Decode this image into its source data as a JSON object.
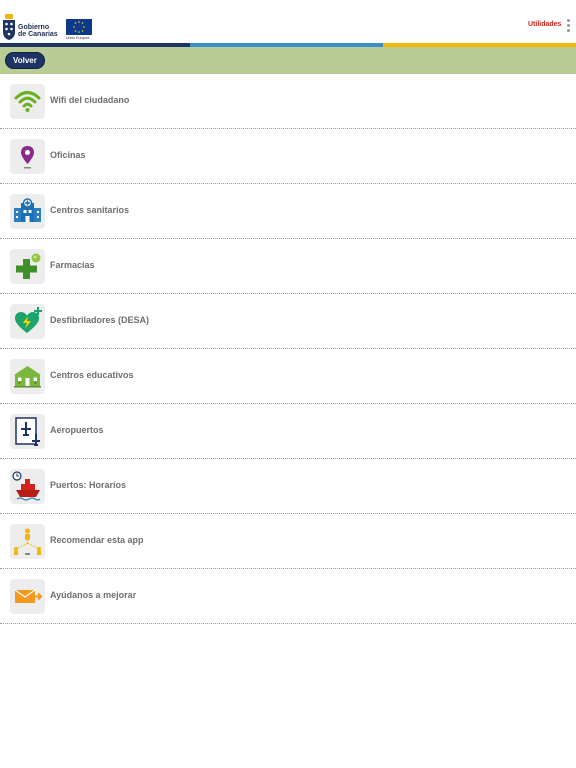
{
  "header": {
    "brand_line1": "Gobierno",
    "brand_line2": "de Canarias",
    "eu_caption": "Unión Europea",
    "utilities_label": "Utilidades",
    "stripe_colors": [
      "#1d3464",
      "#3c8ec8",
      "#f2b705"
    ]
  },
  "toolbar": {
    "back_label": "Volver",
    "bg_color": "#b9cc94"
  },
  "menu": {
    "items": [
      {
        "label": "Wifi del ciudadano",
        "icon": "wifi-icon"
      },
      {
        "label": "Oficinas",
        "icon": "location-pin-icon"
      },
      {
        "label": "Centros sanitarios",
        "icon": "hospital-icon"
      },
      {
        "label": "Farmacias",
        "icon": "pharmacy-cross-icon"
      },
      {
        "label": "Desfibriladores (DESA)",
        "icon": "defibrillator-heart-icon"
      },
      {
        "label": "Centros educativos",
        "icon": "school-icon"
      },
      {
        "label": "Aeropuertos",
        "icon": "airport-icon"
      },
      {
        "label": "Puertos: Horarios",
        "icon": "ship-clock-icon"
      },
      {
        "label": "Recomendar esta app",
        "icon": "share-icon"
      },
      {
        "label": "Ayúdanos a mejorar",
        "icon": "mail-forward-icon"
      }
    ]
  }
}
